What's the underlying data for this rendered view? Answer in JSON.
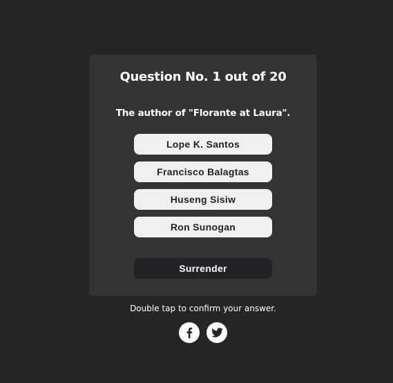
{
  "quiz": {
    "header": "Question No. 1 out of 20",
    "question": "The author of \"Florante at Laura\".",
    "choices": [
      {
        "label": "Lope K. Santos"
      },
      {
        "label": "Francisco Balagtas"
      },
      {
        "label": "Huseng Sisiw"
      },
      {
        "label": "Ron Sunogan"
      }
    ],
    "surrender_label": "Surrender"
  },
  "footer": {
    "hint": "Double tap to confirm your answer.",
    "social": [
      {
        "icon": "facebook-icon"
      },
      {
        "icon": "twitter-icon"
      }
    ]
  },
  "colors": {
    "background": "#252525",
    "card": "#333333",
    "choice_bg": "#f0f0f0",
    "surrender_bg": "#222226"
  }
}
